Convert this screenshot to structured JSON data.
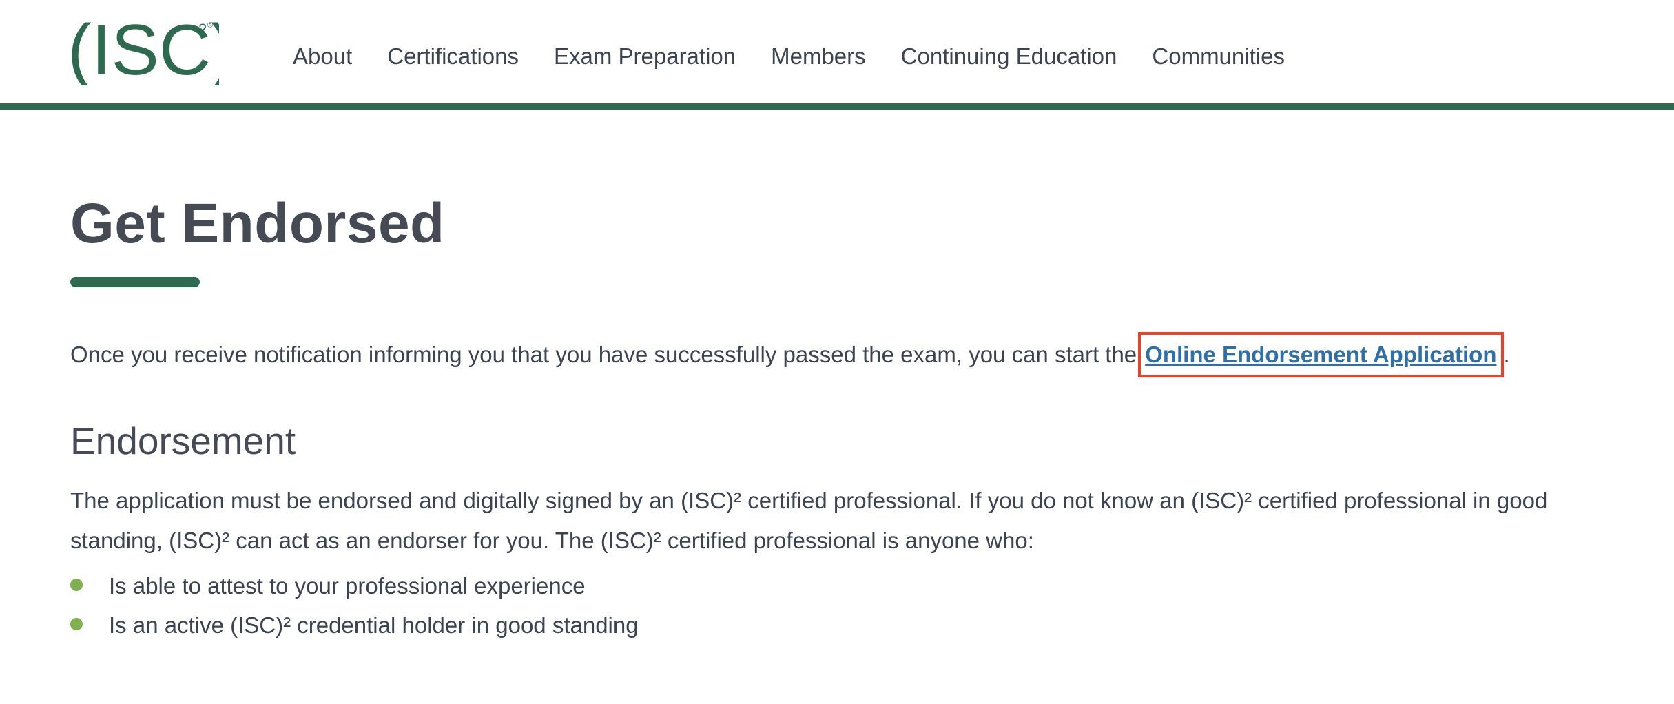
{
  "header": {
    "logo_text": "(ISC)",
    "logo_superscript": "2",
    "logo_registered": "®",
    "nav": [
      {
        "label": "About"
      },
      {
        "label": "Certifications"
      },
      {
        "label": "Exam Preparation"
      },
      {
        "label": "Members"
      },
      {
        "label": "Continuing Education"
      },
      {
        "label": "Communities"
      }
    ]
  },
  "main": {
    "title": "Get Endorsed",
    "intro_text": "Once you receive notification informing you that you have successfully passed the exam, you can start the",
    "intro_link": "Online Endorsement Application",
    "intro_end": ".",
    "section_heading": "Endorsement",
    "section_body": "The application must be endorsed and digitally signed by an (ISC)² certified professional. If you do not know an (ISC)² certified professional in good standing, (ISC)² can act as an endorser for you. The (ISC)² certified professional is anyone who:",
    "bullets": [
      {
        "text": "Is able to attest to your professional experience"
      },
      {
        "text": "Is an active (ISC)² credential holder in good standing"
      }
    ]
  },
  "colors": {
    "brand_green": "#2d6a4f",
    "bullet_green": "#7fb04f",
    "link_blue": "#2f6fa8",
    "highlight_red": "#e5432c"
  }
}
